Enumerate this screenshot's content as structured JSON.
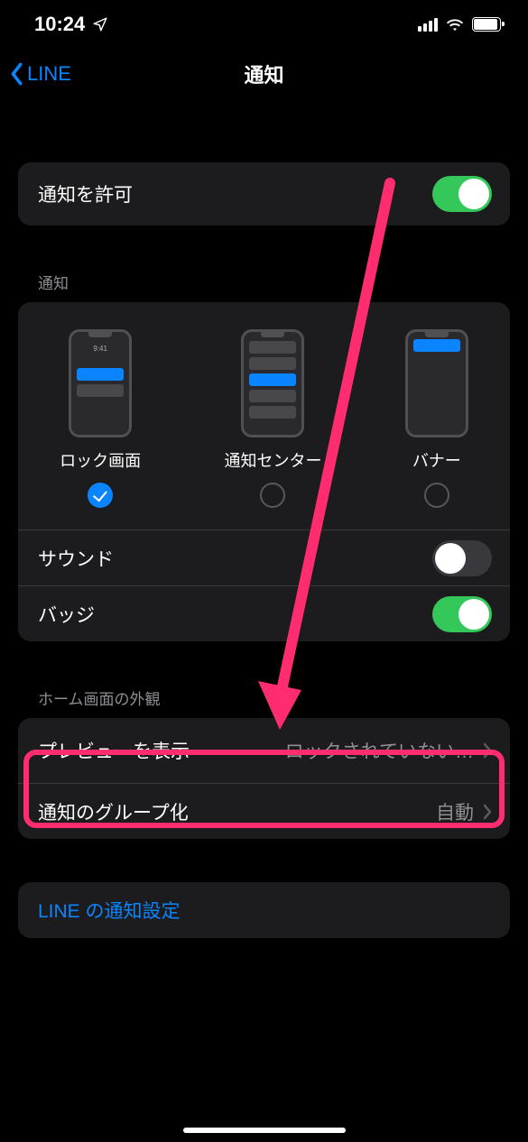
{
  "status": {
    "time": "10:24"
  },
  "nav": {
    "back_label": "LINE",
    "title": "通知"
  },
  "section_allow": {
    "allow_label": "通知を許可"
  },
  "section_alerts": {
    "header": "通知",
    "styles": {
      "lock": {
        "label": "ロック画面",
        "mock_time": "9:41"
      },
      "center": {
        "label": "通知センター"
      },
      "banner": {
        "label": "バナー"
      }
    },
    "sound_label": "サウンド",
    "badge_label": "バッジ"
  },
  "section_appearance": {
    "header": "ホーム画面の外観",
    "preview_label": "プレビューを表示",
    "preview_value": "ロックされていない…",
    "grouping_label": "通知のグループ化",
    "grouping_value": "自動"
  },
  "section_app": {
    "link_label": "LINE の通知設定"
  }
}
